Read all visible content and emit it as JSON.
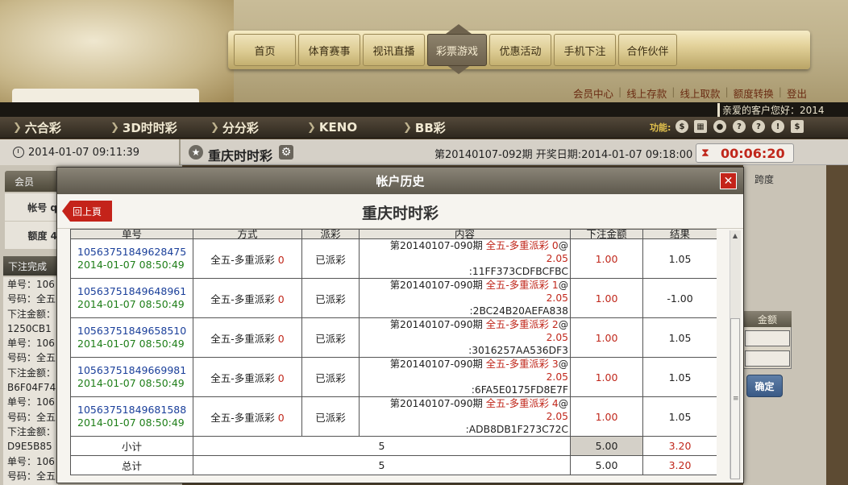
{
  "nav": {
    "items": [
      "首页",
      "体育赛事",
      "视讯直播",
      "彩票游戏",
      "优惠活动",
      "手机下注",
      "合作伙伴"
    ],
    "active": "彩票游戏"
  },
  "member_links": [
    "会员中心",
    "线上存款",
    "线上取款",
    "额度转换",
    "登出"
  ],
  "greeting": "亲爱的客户您好：2014",
  "categories": [
    "六合彩",
    "3D时时彩",
    "分分彩",
    "KENO",
    "BB彩"
  ],
  "func_label": "功能:",
  "func_icons": [
    "coins-icon",
    "calendar-icon",
    "user-icon",
    "help-icon",
    "question-icon",
    "shield-icon",
    "dollar-icon"
  ],
  "time_left": "2014-01-07 09:11:39",
  "game_name": "重庆时时彩",
  "period_info": "第20140107-092期   开奖日期:2014-01-07 09:18:00",
  "countdown": "00:06:20",
  "left_panel": {
    "member_header": "会员",
    "account_label": "帐号 q",
    "credit_label": "额度 4",
    "bet_header": "下注完成",
    "bet_lines": [
      "单号：106",
      "号码：全五",
      "下注金额：",
      "1250CB1",
      "单号：106",
      "号码：全五",
      "下注金额：",
      "B6F04F74",
      "单号：106",
      "号码：全五",
      "下注金额：",
      "D9E5B85",
      "单号：106",
      "号码：全五"
    ]
  },
  "right_panel": {
    "span_label": "跨度",
    "amount_header": "金额",
    "confirm": "确定"
  },
  "modal": {
    "title": "帐户历史",
    "back": "回上頁",
    "subtitle": "重庆时时彩",
    "columns": [
      "单号",
      "方式",
      "派彩",
      "内容",
      "下注金额",
      "结果"
    ],
    "rows": [
      {
        "id": "10563751849628475",
        "time": "2014-01-07 08:50:49",
        "method": "全五-多重派彩 ",
        "method_num": "0",
        "status": "已派彩",
        "period": "第20140107-090期  ",
        "content_red": "全五-多重派彩 0",
        "content_at": "@",
        "odds": "2.05",
        "code": ":11FF373CDFBCFBC",
        "amount": "1.00",
        "result": "1.05"
      },
      {
        "id": "10563751849648961",
        "time": "2014-01-07 08:50:49",
        "method": "全五-多重派彩 ",
        "method_num": "0",
        "status": "已派彩",
        "period": "第20140107-090期  ",
        "content_red": "全五-多重派彩 1",
        "content_at": "@",
        "odds": "2.05",
        "code": ":2BC24B20AEFA838",
        "amount": "1.00",
        "result": "-1.00"
      },
      {
        "id": "10563751849658510",
        "time": "2014-01-07 08:50:49",
        "method": "全五-多重派彩 ",
        "method_num": "0",
        "status": "已派彩",
        "period": "第20140107-090期  ",
        "content_red": "全五-多重派彩 2",
        "content_at": "@",
        "odds": "2.05",
        "code": ":3016257AA536DF3",
        "amount": "1.00",
        "result": "1.05"
      },
      {
        "id": "10563751849669981",
        "time": "2014-01-07 08:50:49",
        "method": "全五-多重派彩 ",
        "method_num": "0",
        "status": "已派彩",
        "period": "第20140107-090期  ",
        "content_red": "全五-多重派彩 3",
        "content_at": "@",
        "odds": "2.05",
        "code": ":6FA5E0175FD8E7F",
        "amount": "1.00",
        "result": "1.05"
      },
      {
        "id": "10563751849681588",
        "time": "2014-01-07 08:50:49",
        "method": "全五-多重派彩 ",
        "method_num": "0",
        "status": "已派彩",
        "period": "第20140107-090期  ",
        "content_red": "全五-多重派彩 4",
        "content_at": "@",
        "odds": "2.05",
        "code": ":ADB8DB1F273C72C",
        "amount": "1.00",
        "result": "1.05"
      }
    ],
    "subtotal": {
      "label": "小计",
      "count": "5",
      "amount": "5.00",
      "result": "3.20"
    },
    "total": {
      "label": "总计",
      "count": "5",
      "amount": "5.00",
      "result": "3.20"
    }
  }
}
